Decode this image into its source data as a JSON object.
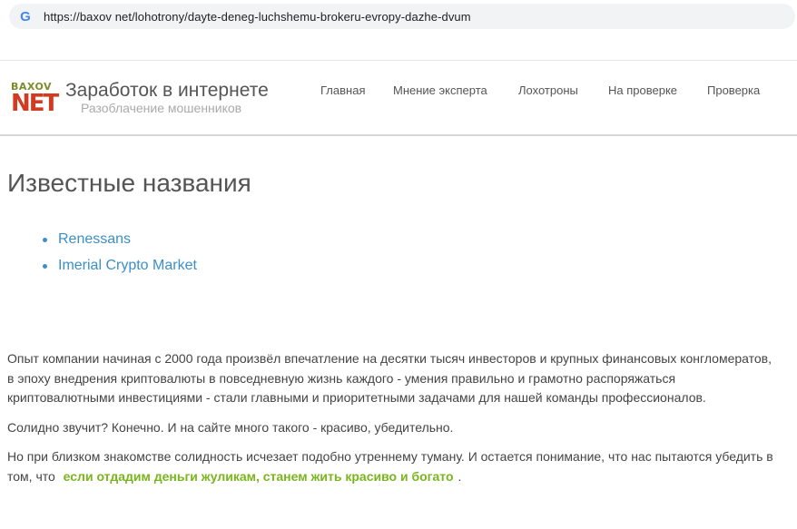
{
  "browser": {
    "url": "https://baxov net/lohotrony/dayte-deneg-luchshemu-brokeru-evropy-dazhe-dvum"
  },
  "site": {
    "logo_top": "BAXOV",
    "logo_bottom": "NET",
    "title": "Заработок в интернете",
    "subtitle": "Разоблачение мошенников",
    "nav": [
      "Главная",
      "Мнение эксперта",
      "Лохотроны",
      "На проверке",
      "Проверка"
    ]
  },
  "main": {
    "heading": "Известные названия",
    "names": [
      "Renessans",
      "Imerial Crypto Market"
    ],
    "paragraphs": {
      "p1": "Опыт компании начиная с 2000 года произвёл впечатление на десятки тысяч инвесторов и крупных финансовых конгломератов, в эпоху внедрения криптовалюты в повседневную жизнь каждого - умения правильно и грамотно распоряжаться криптовалютными инвестициями - стали главными и приоритетными задачами для нашей команды профессионалов.",
      "p2": "Солидно звучит? Конечно. И на сайте много такого - красиво, убедительно.",
      "p3_start": "Но при близком знакомстве солидность исчезает подобно утреннему туману. И остается понимание, что нас пытаются убедить в том, что",
      "p3_highlight": "если отдадим деньги жуликам, станем жить красиво и богато",
      "p3_end": "."
    }
  },
  "colors": {
    "link": "#3b8fc9",
    "highlight": "#79b51c",
    "logo_red": "#d23b1f",
    "logo_olive": "#7d8c2a"
  }
}
